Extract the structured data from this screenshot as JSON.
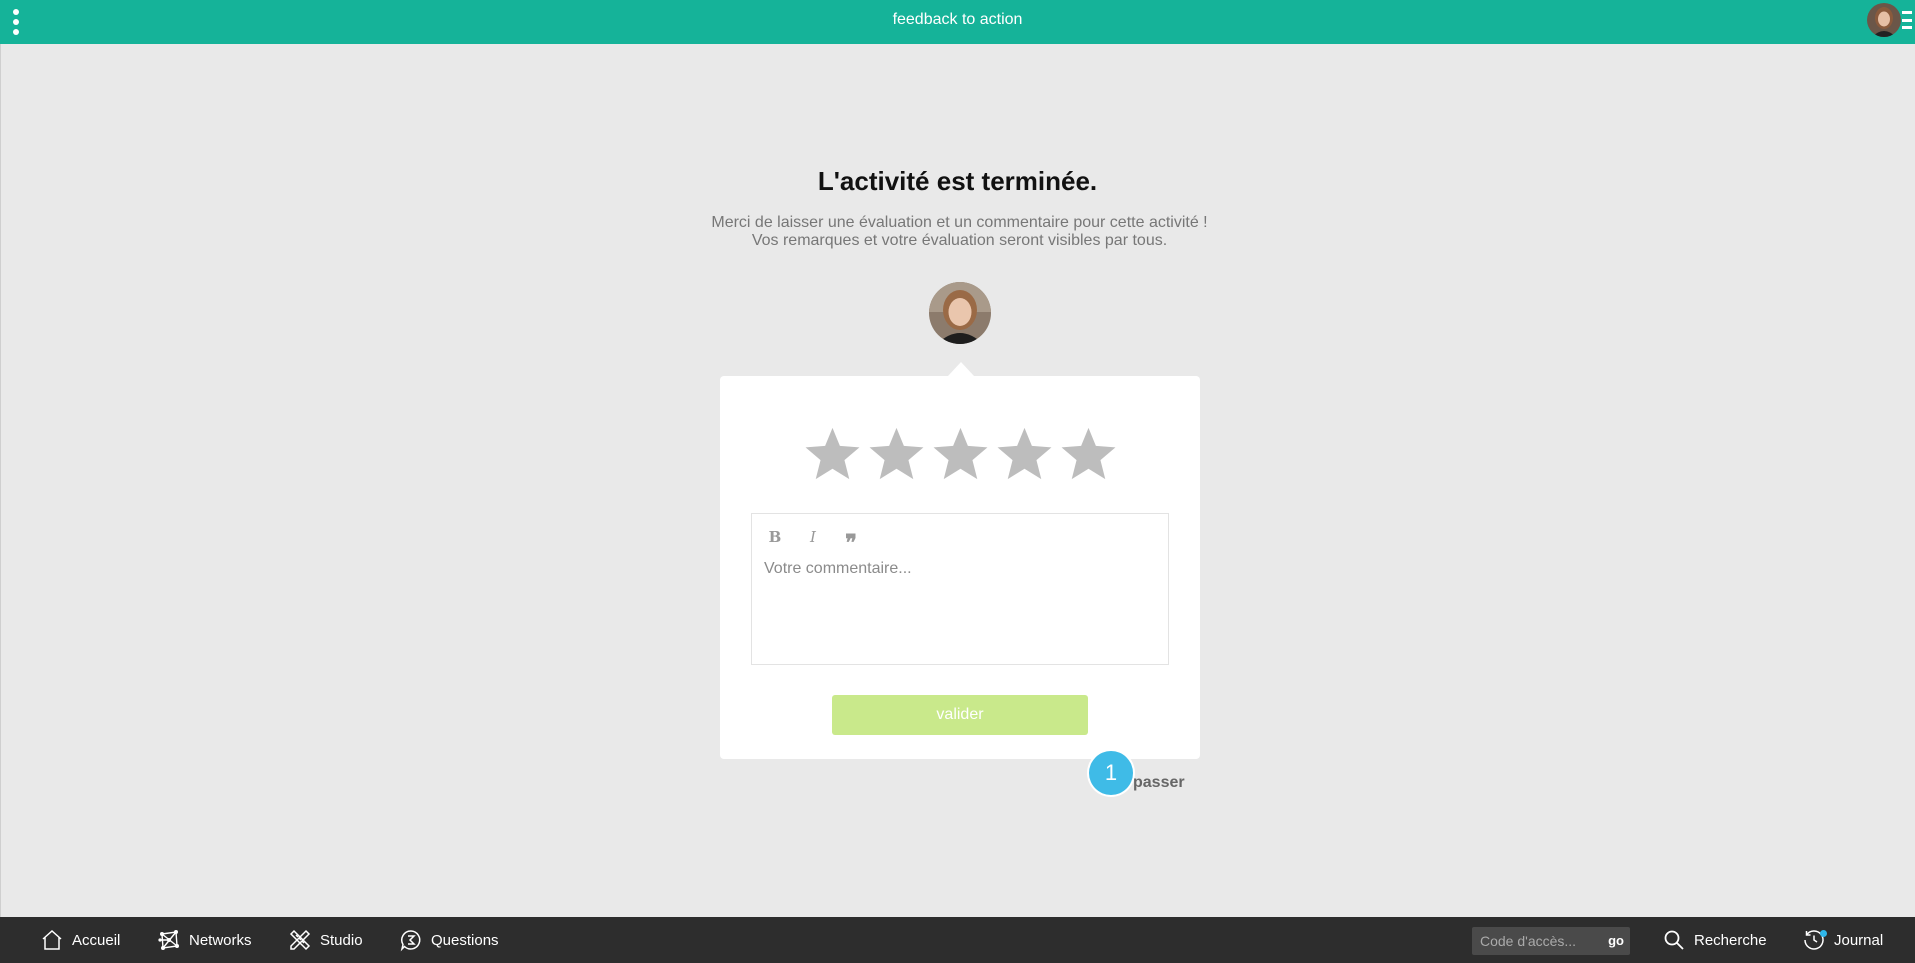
{
  "header": {
    "title": "feedback to action"
  },
  "main": {
    "heading": "L'activité est terminée.",
    "subtitle": "Merci de laisser une évaluation et un commentaire pour cette activité ! Vos remarques et votre évaluation seront visibles par tous."
  },
  "rating": {
    "value": 0,
    "max": 5,
    "empty_color": "#bdbdbd"
  },
  "editor": {
    "placeholder": "Votre commentaire...",
    "bold_label": "B",
    "italic_label": "I",
    "quote_label": "❞"
  },
  "actions": {
    "submit_label": "valider",
    "skip_label": "passer",
    "step_number": "1"
  },
  "bottom_nav": {
    "items": [
      {
        "label": "Accueil",
        "icon": "home-icon"
      },
      {
        "label": "Networks",
        "icon": "network-icon"
      },
      {
        "label": "Studio",
        "icon": "studio-tools-icon"
      },
      {
        "label": "Questions",
        "icon": "question-bubble-icon"
      }
    ],
    "access_placeholder": "Code d'accès...",
    "access_go": "go",
    "search_label": "Recherche",
    "journal_label": "Journal"
  },
  "colors": {
    "topbar": "#15b399",
    "bottombar": "#2d2d2d",
    "submit": "#c9e98b",
    "badge": "#3fbbe7"
  }
}
